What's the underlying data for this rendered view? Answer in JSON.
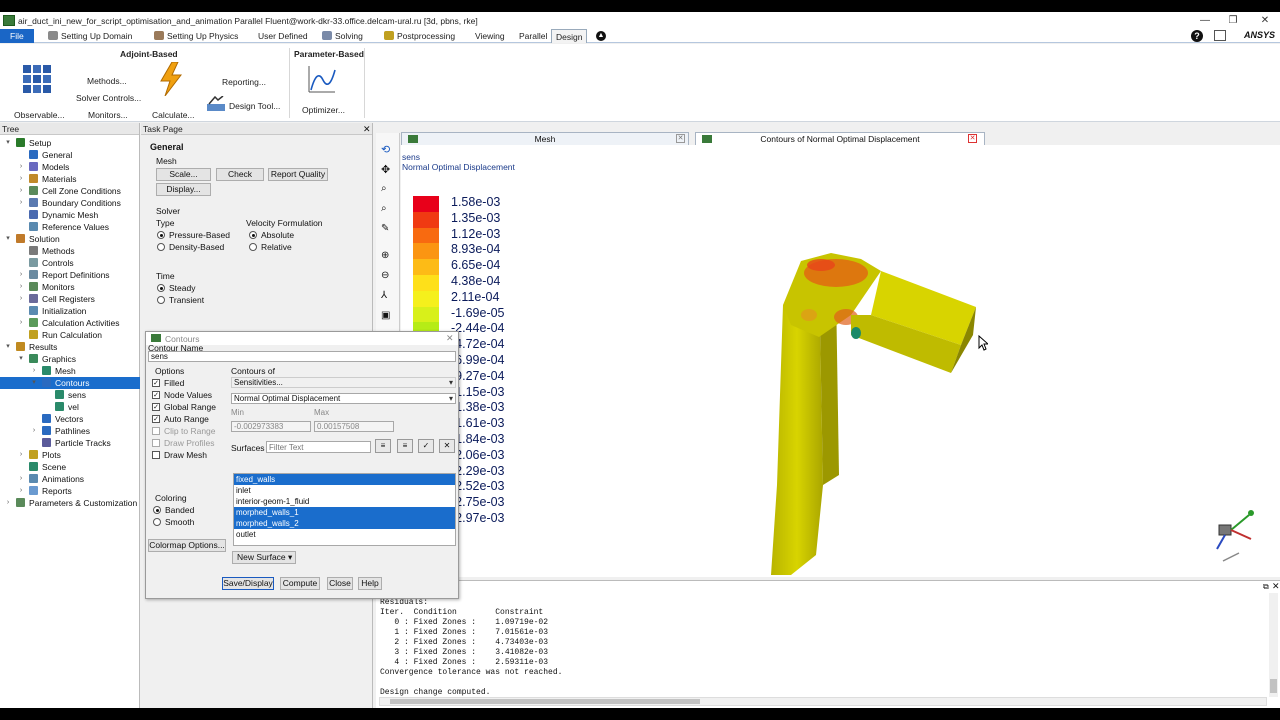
{
  "window": {
    "title": "air_duct_ini_new_for_script_optimisation_and_animation Parallel Fluent@work-dkr-33.office.delcam-ural.ru  [3d, pbns, rke]"
  },
  "menu": {
    "tabs": [
      "File",
      "Setting Up Domain",
      "Setting Up Physics",
      "User Defined",
      "Solving",
      "Postprocessing",
      "Viewing",
      "Parallel",
      "Design"
    ]
  },
  "ribbon": {
    "adjoint_title": "Adjoint-Based",
    "param_title": "Parameter-Based",
    "observable": "Observable...",
    "methods": "Methods...",
    "solver_controls": "Solver Controls...",
    "monitors": "Monitors...",
    "calculate": "Calculate...",
    "reporting": "Reporting...",
    "design_tool": "Design Tool...",
    "optimizer": "Optimizer...",
    "brand": "ANSYS"
  },
  "tree": {
    "header": "Tree",
    "items": [
      {
        "label": "Setup",
        "exp": "▾"
      },
      {
        "label": "General",
        "exp": ""
      },
      {
        "label": "Models",
        "exp": "›"
      },
      {
        "label": "Materials",
        "exp": "›"
      },
      {
        "label": "Cell Zone Conditions",
        "exp": "›"
      },
      {
        "label": "Boundary Conditions",
        "exp": "›"
      },
      {
        "label": "Dynamic Mesh",
        "exp": ""
      },
      {
        "label": "Reference Values",
        "exp": ""
      },
      {
        "label": "Solution",
        "exp": "▾"
      },
      {
        "label": "Methods",
        "exp": ""
      },
      {
        "label": "Controls",
        "exp": ""
      },
      {
        "label": "Report Definitions",
        "exp": "›"
      },
      {
        "label": "Monitors",
        "exp": "›"
      },
      {
        "label": "Cell Registers",
        "exp": "›"
      },
      {
        "label": "Initialization",
        "exp": ""
      },
      {
        "label": "Calculation Activities",
        "exp": "›"
      },
      {
        "label": "Run Calculation",
        "exp": ""
      },
      {
        "label": "Results",
        "exp": "▾"
      },
      {
        "label": "Graphics",
        "exp": "▾"
      },
      {
        "label": "Mesh",
        "exp": "›"
      },
      {
        "label": "Contours",
        "exp": "▾"
      },
      {
        "label": "sens",
        "exp": ""
      },
      {
        "label": "vel",
        "exp": ""
      },
      {
        "label": "Vectors",
        "exp": ""
      },
      {
        "label": "Pathlines",
        "exp": "›"
      },
      {
        "label": "Particle Tracks",
        "exp": ""
      },
      {
        "label": "Plots",
        "exp": "›"
      },
      {
        "label": "Scene",
        "exp": ""
      },
      {
        "label": "Animations",
        "exp": "›"
      },
      {
        "label": "Reports",
        "exp": "›"
      },
      {
        "label": "Parameters & Customization",
        "exp": "›"
      }
    ]
  },
  "task": {
    "header": "Task Page",
    "title": "General",
    "mesh_label": "Mesh",
    "scale": "Scale...",
    "check": "Check",
    "report_quality": "Report Quality",
    "display": "Display...",
    "solver_label": "Solver",
    "type_label": "Type",
    "pressure_based": "Pressure-Based",
    "density_based": "Density-Based",
    "velocity_label": "Velocity Formulation",
    "absolute": "Absolute",
    "relative": "Relative",
    "time_label": "Time",
    "steady": "Steady",
    "transient": "Transient"
  },
  "dialog": {
    "title": "Contours",
    "contour_name_label": "Contour Name",
    "contour_name": "sens",
    "options_label": "Options",
    "options": [
      "Filled",
      "Node Values",
      "Global Range",
      "Auto Range",
      "Clip to Range",
      "Draw Profiles",
      "Draw Mesh"
    ],
    "contours_of_label": "Contours of",
    "contours_of": "Sensitivities...",
    "variable": "Normal Optimal Displacement",
    "min_label": "Min",
    "max_label": "Max",
    "min": "-0.002973383",
    "max": "0.00157508",
    "surfaces_label": "Surfaces",
    "filter_placeholder": "Filter Text",
    "surfaces": [
      "fixed_walls",
      "inlet",
      "interior-geom-1_fluid",
      "morphed_walls_1",
      "morphed_walls_2",
      "outlet"
    ],
    "new_surface": "New Surface",
    "coloring_label": "Coloring",
    "banded": "Banded",
    "smooth": "Smooth",
    "colormap_options": "Colormap Options...",
    "save_display": "Save/Display",
    "compute": "Compute",
    "close": "Close",
    "help": "Help"
  },
  "graphics": {
    "tab_mesh": "Mesh",
    "tab_contours": "Contours of Normal Optimal Displacement",
    "legend_title1": "sens",
    "legend_title2": "Normal Optimal Displacement",
    "legend_values": [
      "1.58e-03",
      "1.35e-03",
      "1.12e-03",
      "8.93e-04",
      "6.65e-04",
      "4.38e-04",
      "2.11e-04",
      "-1.69e-05",
      "-2.44e-04",
      "-4.72e-04",
      "-6.99e-04",
      "-9.27e-04",
      "-1.15e-03",
      "-1.38e-03",
      "-1.61e-03",
      "-1.84e-03",
      "-2.06e-03",
      "-2.29e-03",
      "-2.52e-03",
      "-2.75e-03",
      "-2.97e-03"
    ],
    "legend_colors": [
      "#e8001a",
      "#f03a12",
      "#f86a10",
      "#fb9512",
      "#fdbb16",
      "#fee01a",
      "#f5f01c",
      "#d8f01a",
      "#b6ec16",
      "#a5e315",
      "#98d817",
      "#8ccc18",
      "#7fc01a",
      "#72b41c",
      "#66a81d",
      "#5a9c1e",
      "#4e901f",
      "#42841f",
      "#357820",
      "#296c20",
      "#1d6020"
    ]
  },
  "console": {
    "lines": [
      "Residuals:",
      "Iter.  Condition        Constraint",
      "   0 : Fixed Zones :    1.09719e-02",
      "   1 : Fixed Zones :    7.01561e-03",
      "   2 : Fixed Zones :    4.73403e-03",
      "   3 : Fixed Zones :    3.41082e-03",
      "   4 : Fixed Zones :    2.59311e-03",
      "Convergence tolerance was not reached.",
      "",
      "Design change computed."
    ]
  }
}
